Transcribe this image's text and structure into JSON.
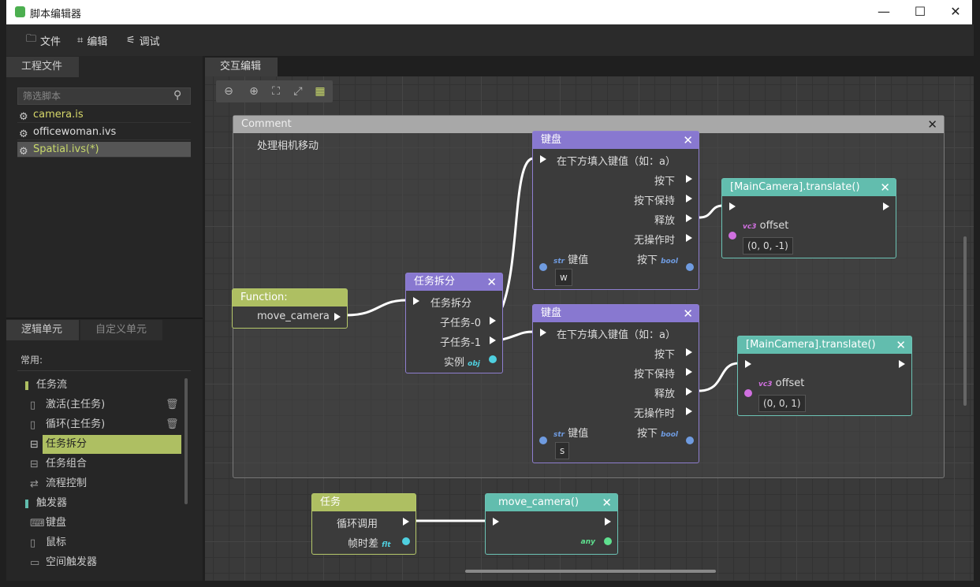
{
  "window": {
    "title": "脚本编辑器"
  },
  "menu": {
    "file": "文件",
    "edit": "编辑",
    "debug": "调试"
  },
  "project": {
    "tab": "工程文件",
    "search_placeholder": "筛选脚本",
    "files": [
      {
        "name": "camera.is"
      },
      {
        "name": "officewoman.ivs"
      },
      {
        "name": "Spatial.ivs(*)"
      }
    ]
  },
  "units": {
    "tab_logic": "逻辑单元",
    "tab_custom": "自定义单元",
    "common_label": "常用:",
    "items": [
      {
        "label": "任务流",
        "kind": "category",
        "color": "#aebf62"
      },
      {
        "label": "激活(主任务)"
      },
      {
        "label": "循环(主任务)"
      },
      {
        "label": "任务拆分",
        "selected": true
      },
      {
        "label": "任务组合"
      },
      {
        "label": "流程控制"
      },
      {
        "label": "触发器",
        "kind": "category",
        "color": "#62bdae"
      },
      {
        "label": "键盘"
      },
      {
        "label": "鼠标"
      },
      {
        "label": "空间触发器"
      }
    ]
  },
  "editor": {
    "tab": "交互编辑"
  },
  "comment": {
    "title": "Comment",
    "text": "处理相机移动"
  },
  "nodes": {
    "function": {
      "title": "Function:",
      "output": "move_camera"
    },
    "split": {
      "title": "任务拆分",
      "in": "任务拆分",
      "out0": "子任务-0",
      "out1": "子任务-1",
      "inst": "实例",
      "inst_type": "obj"
    },
    "key1": {
      "title": "键盘",
      "in": "在下方填入键值（如：a）",
      "press": "按下",
      "hold": "按下保持",
      "release": "释放",
      "idle": "无操作时",
      "keyval": "键值",
      "keyval_type": "str",
      "pressed": "按下",
      "pressed_type": "bool",
      "value": "w"
    },
    "key2": {
      "title": "键盘",
      "in": "在下方填入键值（如：a）",
      "press": "按下",
      "hold": "按下保持",
      "release": "释放",
      "idle": "无操作时",
      "keyval": "键值",
      "keyval_type": "str",
      "pressed": "按下",
      "pressed_type": "bool",
      "value": "s"
    },
    "translate1": {
      "title": "[MainCamera].translate()",
      "param": "offset",
      "param_type": "vc3",
      "value": "(0, 0, -1)"
    },
    "translate2": {
      "title": "[MainCamera].translate()",
      "param": "offset",
      "param_type": "vc3",
      "value": "(0, 0, 1)"
    },
    "task": {
      "title": "任务",
      "loop": "循环调用",
      "delta": "帧时差",
      "delta_type": "flt"
    },
    "call": {
      "title": "move_camera()",
      "ret_type": "any"
    }
  }
}
